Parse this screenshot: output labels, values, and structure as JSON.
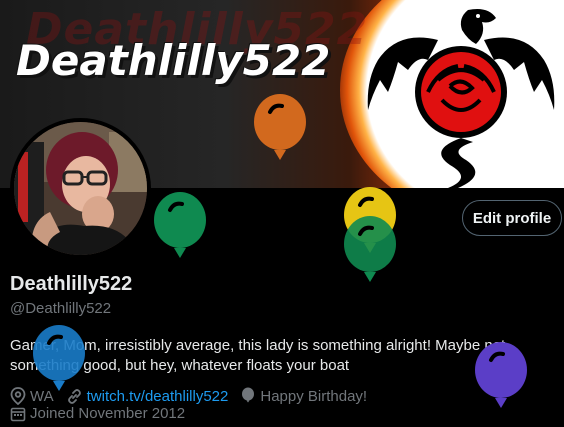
{
  "banner": {
    "title": "Deathlilly522",
    "title_shadow": "Deathlilly522"
  },
  "profile": {
    "display_name": "Deathlilly522",
    "handle": "@Deathlilly522",
    "bio": "Gamer, Mom, irresistibly average, this lady is something alright! Maybe not something good, but hey, whatever floats your boat",
    "edit_label": "Edit profile",
    "location": "WA",
    "website": "twitch.tv/deathlilly522",
    "birthday": "Happy Birthday!",
    "joined": "Joined November 2012"
  },
  "icons": [
    "location-icon",
    "link-icon",
    "balloon-icon",
    "calendar-icon"
  ],
  "colors": {
    "accent": "#1d9bf0",
    "balloon_orange": "#d2691e",
    "balloon_green": "#0f8a50",
    "balloon_yellow": "#e6c514",
    "balloon_blue": "#1a7cc9",
    "balloon_purple": "#5b3ec7"
  }
}
